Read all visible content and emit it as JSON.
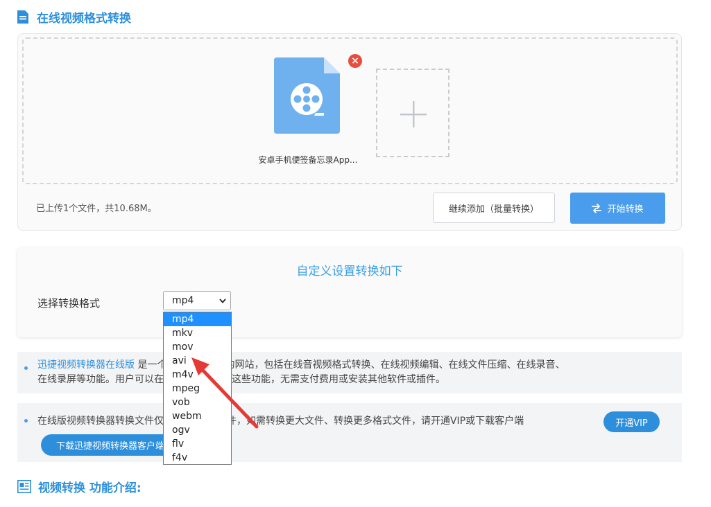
{
  "header": {
    "title": "在线视频格式转换",
    "icon": "document-icon"
  },
  "upload": {
    "file_name": "安卓手机便签备忘录App...",
    "remove_symbol": "×",
    "status": "已上传1个文件，共10.68M。",
    "continue_add_label": "继续添加（批量转换）",
    "start_convert_label": "开始转换"
  },
  "settings": {
    "title": "自定义设置转换如下",
    "format_label": "选择转换格式",
    "selected_format": "mp4",
    "options": [
      "mp4",
      "mkv",
      "mov",
      "avi",
      "m4v",
      "mpeg",
      "vob",
      "webm",
      "ogv",
      "flv",
      "f4v"
    ]
  },
  "info1": {
    "link": "迅捷视频转换器在线版",
    "text1": " 是一个提供在线功能的网站，包括在线音视频格式转换、在线视频编辑、在线文件压缩、在线录音、",
    "text2": "在线录屏等功能。用户可以在网站上免费试用这些功能，无需支付费用或安装其他软件或插件。"
  },
  "info2": {
    "text": "在线版视频转换器转换文件仅支持2M以内文件，如需转换更大文件、转换更多格式文件，请开通VIP或下载客户端",
    "vip_label": "开通VIP",
    "download_label": "下载迅捷视频转换器客户端"
  },
  "features": {
    "title": "视频转换 功能介绍:",
    "icon": "news-icon"
  },
  "colors": {
    "accent": "#2d8fdb",
    "button": "#4a9ded",
    "danger": "#e74c3c",
    "annotation": "#e53935"
  }
}
